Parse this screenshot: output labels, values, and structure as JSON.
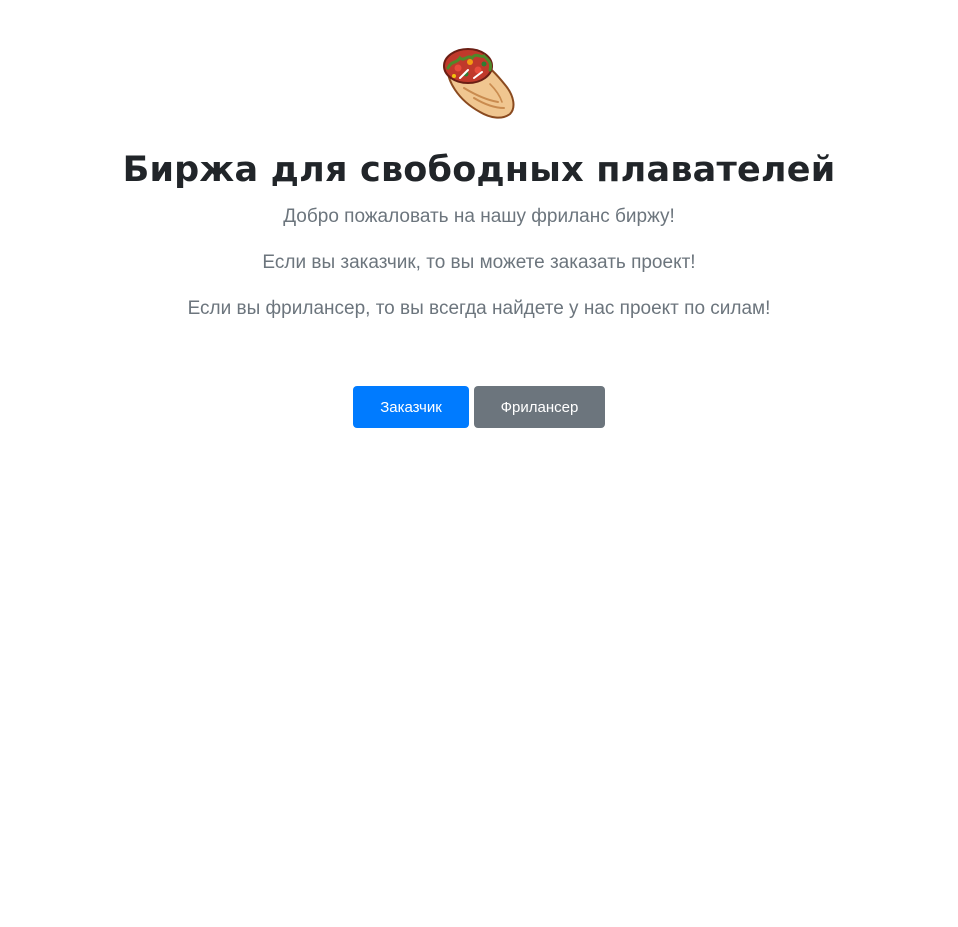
{
  "logo": {
    "icon": "burrito-icon"
  },
  "hero": {
    "title": "Биржа для свободных плавателей",
    "line1": "Добро пожаловать на нашу фриланс биржу!",
    "line2": "Если вы заказчик, то вы можете заказать проект!",
    "line3": "Если вы фрилансер, то вы всегда найдете у нас проект по силам!"
  },
  "buttons": {
    "customer_label": "Заказчик",
    "freelancer_label": "Фрилансер"
  },
  "colors": {
    "primary": "#007bff",
    "secondary": "#6c757d",
    "title_text": "#212529",
    "muted_text": "#6c757d"
  }
}
